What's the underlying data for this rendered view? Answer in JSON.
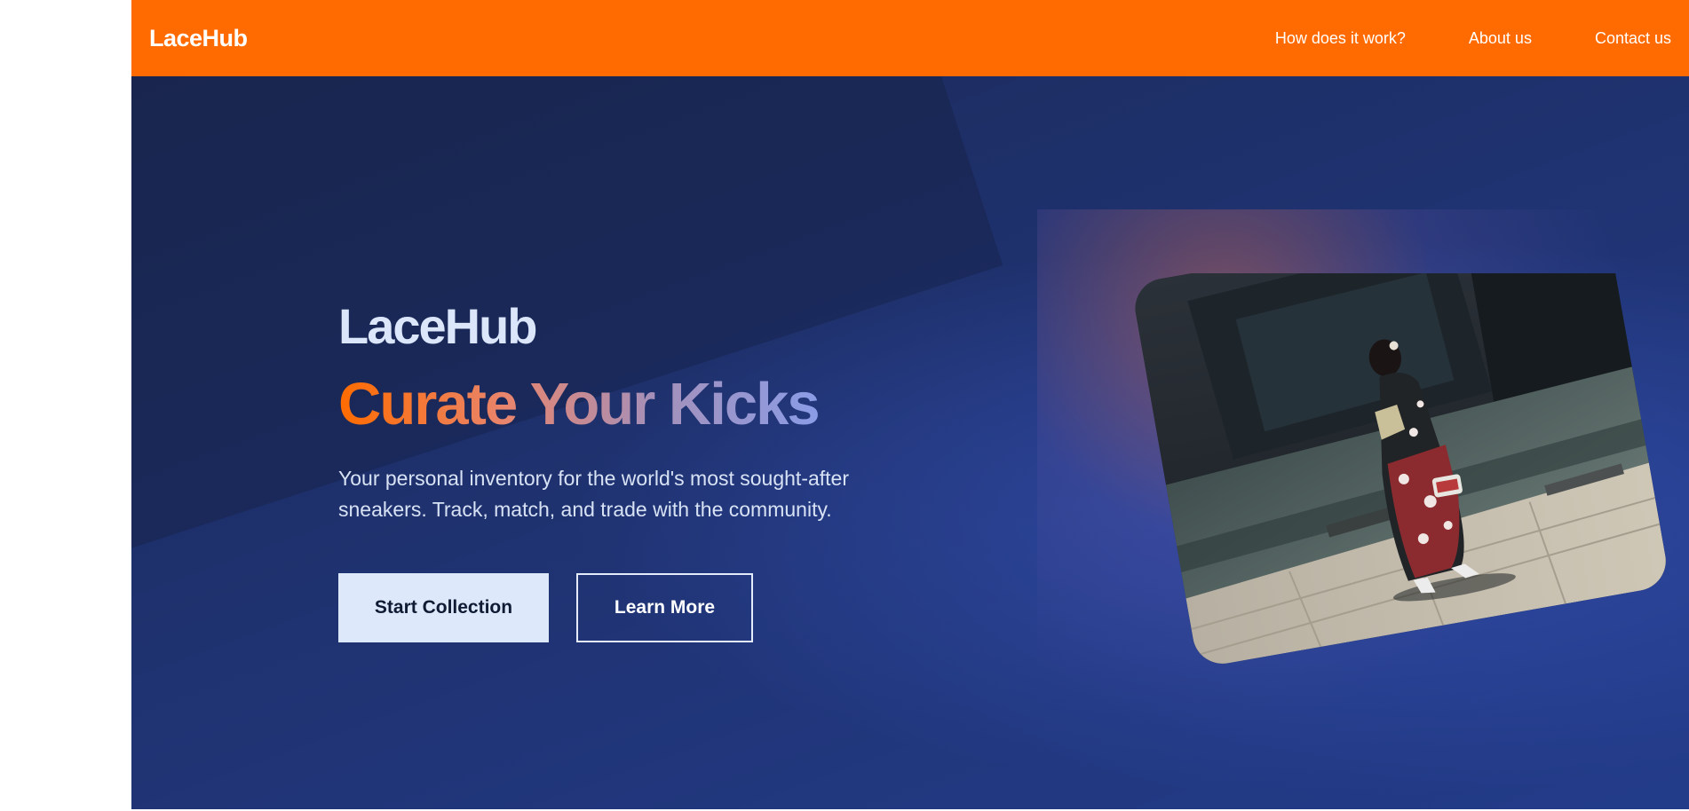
{
  "navbar": {
    "brand": "LaceHub",
    "links": [
      "How does it work?",
      "About us",
      "Contact us"
    ]
  },
  "hero": {
    "brand": "LaceHub",
    "tagline": "Curate Your Kicks",
    "description_line1": "Your personal inventory for the world's most sought-after",
    "description_line2": "sneakers. Track, match, and trade with the community.",
    "primary_button": "Start Collection",
    "secondary_button": "Learn More",
    "image_alt": "woman-in-kimono-walking-street-photo"
  },
  "colors": {
    "nav_bg": "#ff6b00",
    "hero_bg": "#1f3270",
    "primary_btn_bg": "#dde8fb"
  }
}
